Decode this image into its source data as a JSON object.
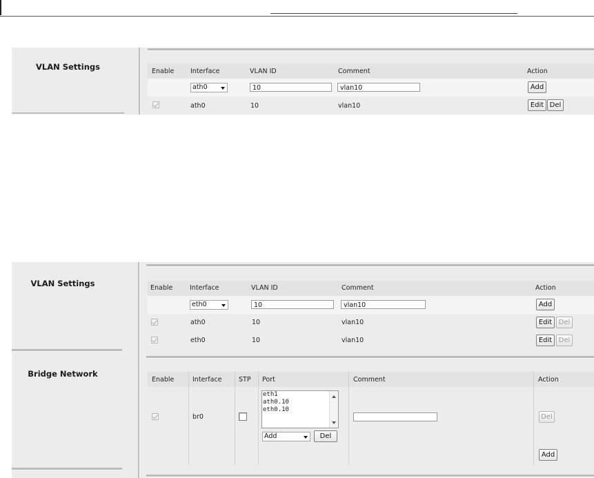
{
  "vlan_section_1": {
    "title": "VLAN Settings",
    "headers": {
      "enable": "Enable",
      "interface": "Interface",
      "vlan_id": "VLAN ID",
      "comment": "Comment",
      "action": "Action"
    },
    "new_row": {
      "interface": "ath0",
      "vlan_id": "10",
      "comment": "vlan10",
      "add_label": "Add"
    },
    "rows": [
      {
        "interface": "ath0",
        "vlan_id": "10",
        "comment": "vlan10",
        "edit_label": "Edit",
        "del_label": "Del"
      }
    ]
  },
  "vlan_section_2": {
    "title": "VLAN Settings",
    "headers": {
      "enable": "Enable",
      "interface": "Interface",
      "vlan_id": "VLAN ID",
      "comment": "Comment",
      "action": "Action"
    },
    "new_row": {
      "interface": "eth0",
      "vlan_id": "10",
      "comment": "vlan10",
      "add_label": "Add"
    },
    "rows": [
      {
        "interface": "ath0",
        "vlan_id": "10",
        "comment": "vlan10",
        "edit_label": "Edit",
        "del_label": "Del"
      },
      {
        "interface": "eth0",
        "vlan_id": "10",
        "comment": "vlan10",
        "edit_label": "Edit",
        "del_label": "Del"
      }
    ]
  },
  "bridge_section": {
    "title": "Bridge Network",
    "headers": {
      "enable": "Enable",
      "interface": "Interface",
      "stp": "STP",
      "port": "Port",
      "comment": "Comment",
      "action": "Action"
    },
    "row": {
      "interface": "br0",
      "ports": [
        "eth1",
        "ath0.10",
        "eth0.10"
      ],
      "port_select": "Add",
      "port_del_label": "Del",
      "comment": "",
      "del_label": "Del"
    },
    "add_label": "Add"
  },
  "icons": {
    "dropdown": "chevron-down-icon",
    "checkbox": "checkbox-icon",
    "scroll-up": "scroll-up-icon",
    "scroll-down": "scroll-down-icon"
  }
}
